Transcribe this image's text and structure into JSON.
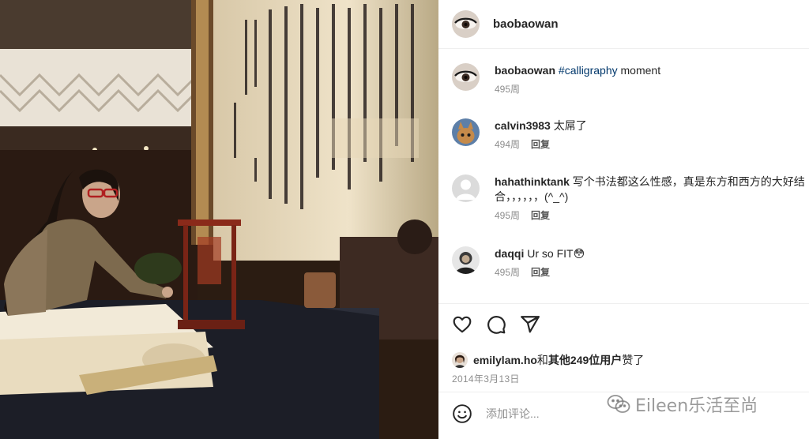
{
  "header": {
    "username": "baobaowan"
  },
  "caption": {
    "username": "baobaowan",
    "hashtag": "#calligraphy",
    "text": " moment",
    "time": "495周"
  },
  "comments": [
    {
      "username": "calvin3983",
      "text": "太屌了",
      "time": "494周",
      "reply_label": "回复",
      "avatar_icon": "cat-avatar"
    },
    {
      "username": "hahathinktank",
      "text": "写个书法都这么性感，真是东方和西方的大好结",
      "text_line2": "合，，，，，，(^_^)",
      "time": "495周",
      "reply_label": "回复",
      "avatar_icon": "default-avatar"
    },
    {
      "username": "daqqi",
      "text": "Ur so FIT😳",
      "time": "495周",
      "reply_label": "回复",
      "avatar_icon": "portrait-avatar"
    }
  ],
  "actions": {
    "like_icon": "heart-icon",
    "comment_icon": "speech-bubble-icon",
    "share_icon": "paper-plane-icon"
  },
  "likes": {
    "user": "emilylam.ho",
    "connector": "和",
    "others": "其他249位用户",
    "suffix": "赞了"
  },
  "date": "2014年3月13日",
  "add_comment": {
    "placeholder": "添加评论...",
    "emoji_icon": "smiley-icon"
  },
  "watermark": {
    "text": "Eileen乐活至尚",
    "icon": "wechat-icon"
  },
  "colors": {
    "link": "#00376b",
    "muted": "#8e8e8e",
    "text": "#262626"
  }
}
